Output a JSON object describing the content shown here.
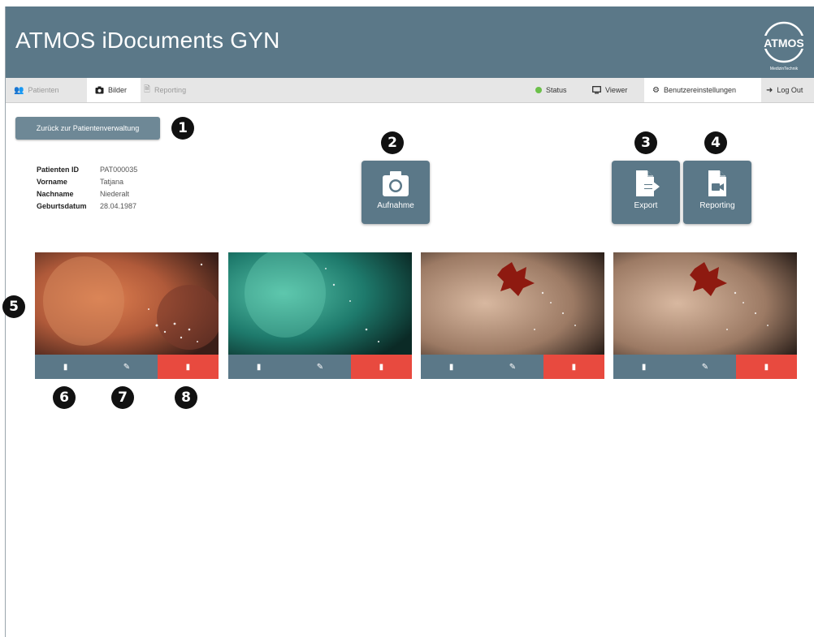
{
  "app": {
    "title": "ATMOS iDocuments GYN",
    "logo_text": "ATMOS",
    "logo_subtext": "MedizinTechnik"
  },
  "nav": {
    "tabs": [
      {
        "label": "Patienten",
        "icon": "users-icon",
        "state": "disabled"
      },
      {
        "label": "Bilder",
        "icon": "camera-icon",
        "state": "active"
      },
      {
        "label": "Reporting",
        "icon": "document-icon",
        "state": "disabled"
      }
    ],
    "right": [
      {
        "label": "Status",
        "icon": "status-dot-icon"
      },
      {
        "label": "Viewer",
        "icon": "monitor-icon"
      },
      {
        "label": "Benutzereinstellungen",
        "icon": "gear-icon"
      },
      {
        "label": "Log Out",
        "icon": "logout-icon"
      }
    ]
  },
  "back_button": {
    "label": "Zurück zur Patientenverwaltung"
  },
  "patient": {
    "fields": [
      {
        "label": "Patienten ID",
        "value": "PAT000035"
      },
      {
        "label": "Vorname",
        "value": "Tatjana"
      },
      {
        "label": "Nachname",
        "value": "Niederalt"
      },
      {
        "label": "Geburtsdatum",
        "value": "28.04.1987"
      }
    ]
  },
  "actions": {
    "capture": {
      "label": "Aufnahme",
      "icon": "camera-icon"
    },
    "export": {
      "label": "Export",
      "icon": "file-export-icon"
    },
    "reporting": {
      "label": "Reporting",
      "icon": "file-video-icon"
    }
  },
  "markers": [
    "1",
    "2",
    "3",
    "4",
    "5",
    "6",
    "7",
    "8"
  ],
  "thumbnails": [
    {
      "name": "image-1",
      "style": "orange"
    },
    {
      "name": "image-2",
      "style": "green"
    },
    {
      "name": "image-3",
      "style": "tissue-red"
    },
    {
      "name": "image-4",
      "style": "tissue-red"
    }
  ],
  "colors": {
    "header": "#5b7888",
    "button": "#5b7888",
    "delete": "#e84a3f",
    "status": "#6cc04a"
  }
}
